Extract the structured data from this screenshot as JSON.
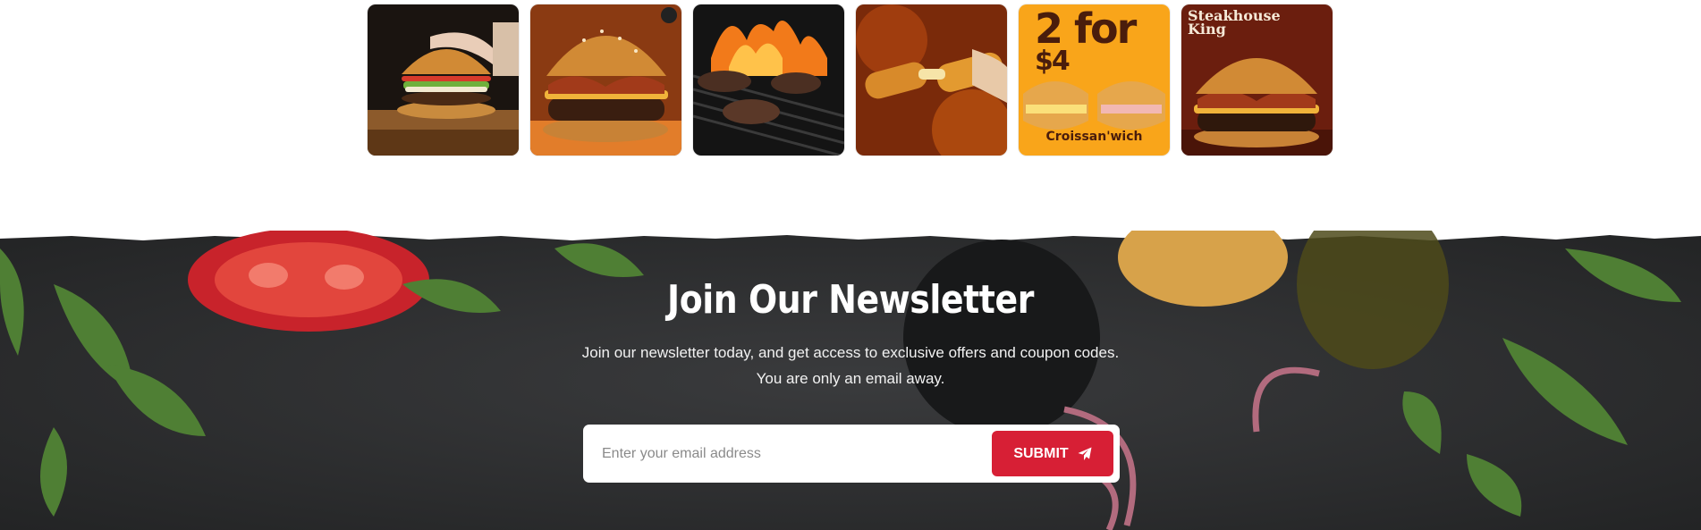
{
  "gallery": {
    "items": [
      {
        "name": "burger-prep"
      },
      {
        "name": "bacon-burger"
      },
      {
        "name": "grill-patties"
      },
      {
        "name": "mozzarella-stick"
      },
      {
        "name": "croissanwich-promo",
        "headline": "2 for",
        "price": "$4",
        "caption": "Croissan'wich"
      },
      {
        "name": "steakhouse-king",
        "headline_line1": "Steakhouse",
        "headline_line2": "King"
      }
    ]
  },
  "newsletter": {
    "title": "Join Our Newsletter",
    "description_line1": "Join our newsletter today, and get access to exclusive offers and coupon codes.",
    "description_line2": "You are only an email away.",
    "email_placeholder": "Enter your email address",
    "email_value": "",
    "submit_label": "SUBMIT",
    "submit_icon": "paper-plane-icon"
  },
  "colors": {
    "accent": "#d71f35",
    "newsletter_bg": "#2b2c2e",
    "text_light": "#ffffff"
  }
}
